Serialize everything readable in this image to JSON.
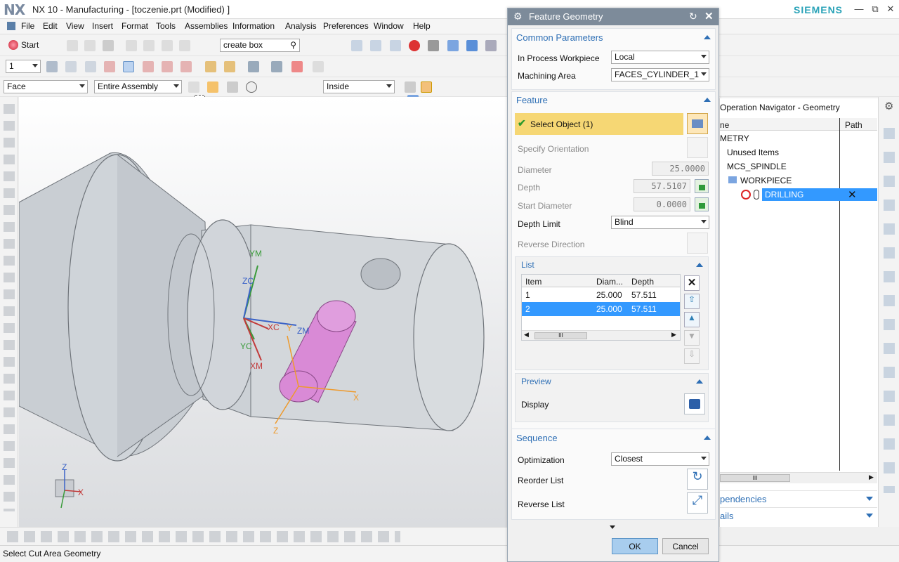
{
  "app": {
    "logo": "NX",
    "title": "NX 10 - Manufacturing - [toczenie.prt (Modified) ]",
    "brand": "SIEMENS"
  },
  "menu": [
    "File",
    "Edit",
    "View",
    "Insert",
    "Format",
    "Tools",
    "Assemblies",
    "Information",
    "Analysis",
    "Preferences",
    "Window",
    "Help"
  ],
  "toolbar": {
    "start_label": "Start",
    "command_search": "create box",
    "layer_value": "1",
    "type_filter": "Face",
    "scope_filter": "Entire Assembly",
    "selection_mode": "Inside"
  },
  "viewport": {
    "labels": {
      "ym": "YM",
      "zc": "ZC",
      "xc": "XC",
      "y": "Y",
      "zm": "ZM",
      "yc": "YC",
      "xm": "XM",
      "x": "X",
      "z": "Z",
      "triad_z": "Z",
      "triad_x": "X"
    }
  },
  "dialog": {
    "title": "Feature Geometry",
    "common": {
      "header": "Common Parameters",
      "workpiece_label": "In Process Workpiece",
      "workpiece_value": "Local",
      "area_label": "Machining Area",
      "area_value": "FACES_CYLINDER_1"
    },
    "feature": {
      "header": "Feature",
      "select_label": "Select Object (1)",
      "orientation_label": "Specify Orientation",
      "diameter_label": "Diameter",
      "diameter_value": "25.0000",
      "depth_label": "Depth",
      "depth_value": "57.5107",
      "start_diameter_label": "Start Diameter",
      "start_diameter_value": "0.0000",
      "depth_limit_label": "Depth Limit",
      "depth_limit_value": "Blind",
      "reverse_label": "Reverse Direction"
    },
    "list": {
      "header": "List",
      "columns": [
        "Item",
        "Diam...",
        "Depth"
      ],
      "rows": [
        {
          "item": "1",
          "diam": "25.000",
          "depth": "57.511"
        },
        {
          "item": "2",
          "diam": "25.000",
          "depth": "57.511"
        }
      ],
      "scroll_glyph": "III"
    },
    "preview": {
      "header": "Preview",
      "display_label": "Display"
    },
    "sequence": {
      "header": "Sequence",
      "optimization_label": "Optimization",
      "optimization_value": "Closest",
      "reorder_label": "Reorder List",
      "reverse_label": "Reverse List"
    },
    "ok_label": "OK",
    "cancel_label": "Cancel"
  },
  "navigator": {
    "title": "Operation Navigator - Geometry",
    "col_name": "ne",
    "col_path": "Path",
    "rows": [
      "METRY",
      "Unused Items",
      "MCS_SPINDLE",
      "WORKPIECE",
      "DRILLING"
    ],
    "dependencies_label": "pendencies",
    "details_label": "ails",
    "scroll_glyph": "III"
  },
  "status": {
    "text": "Select Cut Area Geometry"
  },
  "colors": {
    "accent": "#2e6fb5",
    "header_bar": "#7d8b9a",
    "selection": "#3399ff",
    "select_row": "#f6d774",
    "drill_feature": "#d98ad6"
  }
}
